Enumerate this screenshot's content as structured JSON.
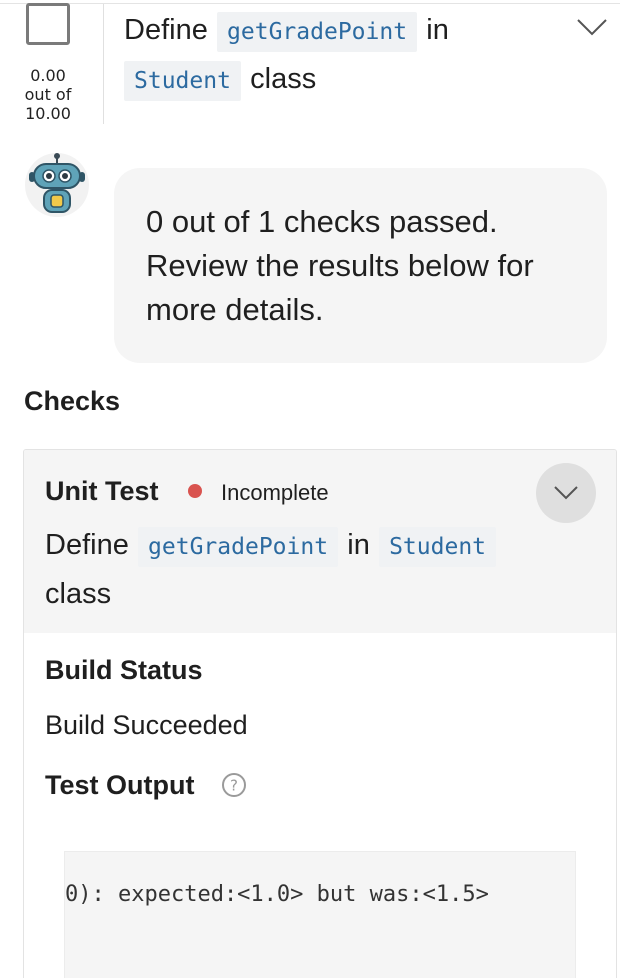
{
  "task": {
    "score_value": "0.00",
    "score_out_of": "out of",
    "score_total": "10.00",
    "title_prefix": "Define",
    "title_method": "getGradePoint",
    "title_in": "in",
    "title_class": "Student",
    "title_suffix": "class"
  },
  "feedback": {
    "message": "0 out of 1 checks passed. Review the results below for more details."
  },
  "checks": {
    "heading": "Checks",
    "items": [
      {
        "type_label": "Unit Test",
        "status": "Incomplete",
        "status_color": "#d9534f",
        "title_prefix": "Define",
        "title_method": "getGradePoint",
        "title_in": "in",
        "title_class": "Student",
        "title_suffix": "class",
        "build_status_label": "Build Status",
        "build_status_value": "Build Succeeded",
        "test_output_label": "Test Output",
        "test_output_text": "0): expected:<1.0> but was:<1.5>"
      }
    ]
  },
  "icons": {
    "task_toggle": "chevron-down-icon",
    "check_expand": "chevron-down-icon",
    "help": "question-circle-icon",
    "assistant": "robot-avatar-icon"
  }
}
